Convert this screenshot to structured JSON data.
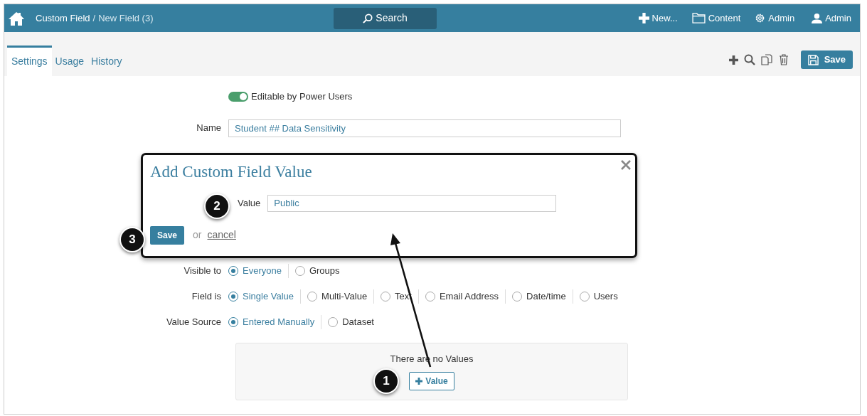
{
  "topbar": {
    "breadcrumb": [
      {
        "text": "Custom Field"
      },
      {
        "text": "New Field (3)"
      }
    ],
    "separator": "/",
    "search": "Search",
    "nav": [
      {
        "kind": "plus",
        "label": "New..."
      },
      {
        "kind": "folder",
        "label": "Content"
      },
      {
        "kind": "gear",
        "label": "Admin"
      },
      {
        "kind": "user",
        "label": "Admin"
      }
    ]
  },
  "tabs": [
    {
      "label": "Settings",
      "selected": true
    },
    {
      "label": "Usage",
      "selected": false
    },
    {
      "label": "History",
      "selected": false
    }
  ],
  "toolbar": {
    "save": "Save"
  },
  "form": {
    "toggle": {
      "label": "Editable by Power Users",
      "on": true
    },
    "name": {
      "label": "Name",
      "value": "Student ## Data Sensitivity"
    },
    "radio_groups": [
      {
        "label": "Visible to",
        "options": [
          {
            "label": "Everyone",
            "selected": true
          },
          {
            "label": "Groups",
            "selected": false
          }
        ]
      },
      {
        "label": "Field is",
        "options": [
          {
            "label": "Single Value",
            "selected": true
          },
          {
            "label": "Multi-Value",
            "selected": false
          },
          {
            "label": "Text",
            "selected": false
          },
          {
            "label": "Email Address",
            "selected": false
          },
          {
            "label": "Date/time",
            "selected": false
          },
          {
            "label": "Users",
            "selected": false
          }
        ]
      },
      {
        "label": "Value Source",
        "options": [
          {
            "label": "Entered Manually",
            "selected": true
          },
          {
            "label": "Dataset",
            "selected": false
          }
        ]
      }
    ],
    "values_box": {
      "empty_text": "There are no Values",
      "button": "Value"
    }
  },
  "modal": {
    "title": "Add Custom Field Value",
    "field_label": "Value",
    "value": "Public",
    "save": "Save",
    "or": "or",
    "cancel": "cancel"
  },
  "callouts": [
    {
      "number": "1"
    },
    {
      "number": "2"
    },
    {
      "number": "3"
    }
  ]
}
